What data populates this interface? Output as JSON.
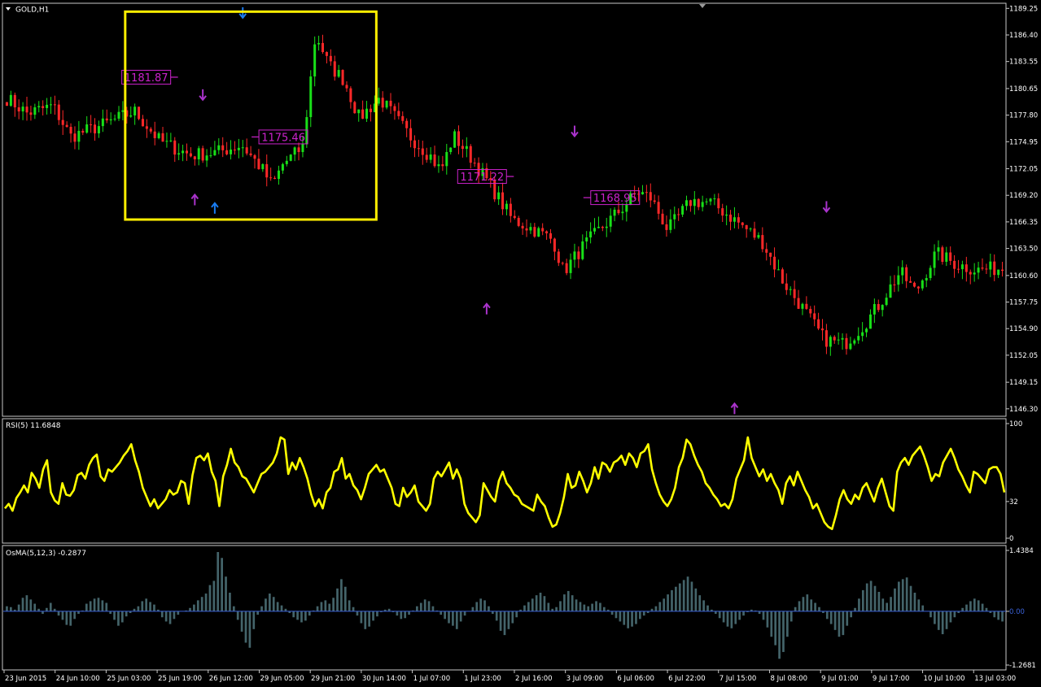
{
  "symbol": "GOLD,H1",
  "colors": {
    "background": "#000000",
    "frame": "#c8c8c8",
    "bull_candle": "#18e018",
    "bear_candle": "#ff2828",
    "rsi_line": "#ffff00",
    "osma_bar": "#44646a",
    "osma_zero": "#3a62d8",
    "highlight_box": "#ffee00",
    "fractal_label": "#cc22cc",
    "arrow_blue": "#1a7cf0",
    "arrow_purple": "#aa33cc"
  },
  "icons": {
    "menu_triangle": "triangle-down-icon",
    "arrow_up": "arrow-up-icon",
    "arrow_down": "arrow-down-icon"
  },
  "chart_data": [
    {
      "type": "candlestick",
      "title": "GOLD,H1",
      "ylim": [
        1145.5,
        1189.8
      ],
      "y_ticks": [
        "1189.25",
        "1186.40",
        "1183.55",
        "1180.65",
        "1177.80",
        "1174.95",
        "1172.05",
        "1169.20",
        "1166.35",
        "1163.50",
        "1160.60",
        "1157.75",
        "1154.90",
        "1152.05",
        "1149.15",
        "1146.30"
      ],
      "x_ticks": [
        "23 Jun 2015",
        "24 Jun 10:00",
        "25 Jun 03:00",
        "25 Jun 19:00",
        "26 Jun 12:00",
        "29 Jun 05:00",
        "29 Jun 21:00",
        "30 Jun 14:00",
        "1 Jul 07:00",
        "1 Jul 23:00",
        "2 Jul 16:00",
        "3 Jul 09:00",
        "6 Jul 06:00",
        "6 Jul 22:00",
        "7 Jul 15:00",
        "8 Jul 08:00",
        "9 Jul 01:00",
        "9 Jul 17:00",
        "10 Jul 10:00",
        "13 Jul 03:00"
      ],
      "bars": 250,
      "path_anchors": [
        [
          0,
          1179.6
        ],
        [
          8,
          1178.0
        ],
        [
          18,
          1178.8
        ],
        [
          25,
          1175.5
        ],
        [
          38,
          1176.8
        ],
        [
          50,
          1178.2
        ],
        [
          60,
          1175.0
        ],
        [
          72,
          1173.5
        ],
        [
          82,
          1173.8
        ],
        [
          92,
          1174.6
        ],
        [
          100,
          1172.0
        ],
        [
          104,
          1170.2
        ],
        [
          108,
          1172.5
        ],
        [
          116,
          1174.4
        ],
        [
          121,
          1186.6
        ],
        [
          126,
          1183.2
        ],
        [
          132,
          1181.6
        ],
        [
          138,
          1177.5
        ],
        [
          146,
          1179.6
        ],
        [
          152,
          1177.6
        ],
        [
          158,
          1175.5
        ],
        [
          166,
          1173.4
        ],
        [
          170,
          1171.8
        ],
        [
          175,
          1175.6
        ],
        [
          182,
          1173.2
        ],
        [
          190,
          1170.0
        ],
        [
          198,
          1166.6
        ],
        [
          206,
          1165.6
        ],
        [
          214,
          1164.4
        ],
        [
          218,
          1161.0
        ],
        [
          226,
          1163.8
        ],
        [
          234,
          1166.0
        ],
        [
          241,
          1167.8
        ],
        [
          247,
          1169.6
        ],
        [
          252,
          1169.0
        ],
        [
          259,
          1165.5
        ],
        [
          268,
          1168.6
        ],
        [
          276,
          1168.4
        ],
        [
          285,
          1166.6
        ],
        [
          296,
          1164.2
        ],
        [
          304,
          1160.0
        ],
        [
          312,
          1157.0
        ],
        [
          320,
          1153.8
        ],
        [
          328,
          1153.2
        ],
        [
          336,
          1155.4
        ],
        [
          342,
          1157.6
        ],
        [
          350,
          1161.0
        ],
        [
          356,
          1158.8
        ],
        [
          364,
          1163.0
        ],
        [
          372,
          1161.8
        ],
        [
          380,
          1161.2
        ],
        [
          390,
          1161.4
        ]
      ],
      "markers": [
        {
          "bar": 74,
          "dir": "up",
          "color": "purple",
          "price": 1169.0
        },
        {
          "bar": 76,
          "dir": "down",
          "color": "purple",
          "price": 1179.7
        },
        {
          "bar": 82,
          "dir": "up",
          "color": "blue",
          "price": 1168.1
        },
        {
          "bar": 92,
          "dir": "down",
          "color": "blue",
          "price": 1188.5
        },
        {
          "bar": 188,
          "dir": "up",
          "color": "purple",
          "price": 1157.3
        },
        {
          "bar": 222,
          "dir": "down",
          "color": "purple",
          "price": 1175.8
        },
        {
          "bar": 285,
          "dir": "up",
          "color": "purple",
          "price": 1146.6
        },
        {
          "bar": 320,
          "dir": "down",
          "color": "purple",
          "price": 1167.7
        }
      ],
      "price_labels": [
        {
          "text": "1181.87",
          "bar": 67,
          "price": 1181.87,
          "side": "left"
        },
        {
          "text": "1175.46",
          "bar": 95,
          "price": 1175.46,
          "side": "right"
        },
        {
          "text": "1171.22",
          "bar": 198,
          "price": 1171.22,
          "side": "left"
        },
        {
          "text": "1168.95",
          "bar": 225,
          "price": 1168.95,
          "side": "right"
        }
      ],
      "highlight_box": {
        "bar_start": 47,
        "bar_end": 144,
        "price_top": 1188.9,
        "price_bottom": 1166.6
      },
      "top_marker": "triangle-down-icon"
    },
    {
      "type": "line",
      "title": "RSI(5) 11.6848",
      "ylim": [
        0,
        100
      ],
      "y_ticks": [
        "100",
        "32",
        "0"
      ],
      "series": [
        {
          "values": [
            26,
            30,
            24,
            35,
            40,
            46,
            40,
            57,
            52,
            44,
            60,
            68,
            40,
            33,
            30,
            48,
            38,
            37,
            42,
            55,
            57,
            52,
            64,
            70,
            73,
            54,
            50,
            60,
            58,
            62,
            66,
            72,
            76,
            82,
            68,
            58,
            44,
            36,
            28,
            34,
            26,
            30,
            34,
            42,
            38,
            40,
            50,
            48,
            30,
            55,
            70,
            72,
            68,
            74,
            58,
            50,
            28,
            54,
            64,
            78,
            66,
            62,
            54,
            52,
            46,
            40,
            48,
            56,
            58,
            62,
            66,
            74,
            88,
            86,
            56,
            66,
            60,
            70,
            62,
            52,
            38,
            28,
            34,
            26,
            40,
            44,
            58,
            60,
            70,
            52,
            56,
            46,
            42,
            34,
            44,
            56,
            60,
            64,
            58,
            60,
            52,
            44,
            30,
            28,
            44,
            36,
            40,
            46,
            32,
            28,
            24,
            30,
            52,
            58,
            54,
            60,
            66,
            52,
            60,
            52,
            30,
            22,
            18,
            14,
            20,
            48,
            42,
            36,
            32,
            50,
            58,
            48,
            44,
            38,
            36,
            30,
            28,
            26,
            24,
            38,
            32,
            28,
            18,
            10,
            12,
            22,
            36,
            56,
            44,
            46,
            58,
            50,
            40,
            48,
            62,
            52,
            66,
            64,
            58,
            66,
            68,
            72,
            64,
            74,
            70,
            62,
            74,
            76,
            82,
            60,
            48,
            38,
            32,
            28,
            34,
            44,
            62,
            70,
            86,
            82,
            72,
            64,
            58,
            48,
            44,
            38,
            34,
            28,
            30,
            26,
            34,
            52,
            60,
            68,
            88,
            70,
            62,
            54,
            60,
            50,
            56,
            48,
            42,
            30,
            48,
            54,
            46,
            58,
            50,
            42,
            36,
            26,
            30,
            22,
            14,
            10,
            8,
            20,
            34,
            42,
            34,
            30,
            38,
            34,
            44,
            48,
            40,
            32,
            44,
            52,
            40,
            28,
            24,
            58,
            66,
            70,
            64,
            72,
            76,
            80,
            72,
            62,
            50,
            56,
            54,
            66,
            72,
            78,
            70,
            60,
            54,
            46,
            40,
            58,
            56,
            52,
            48,
            60,
            62,
            62,
            56,
            40
          ]
        }
      ]
    },
    {
      "type": "bar",
      "title": "OsMA(5,12,3) -0.2877",
      "ylim": [
        -1.2681,
        1.4384
      ],
      "y_ticks": [
        "1.4384",
        "0.00",
        "-1.2681"
      ],
      "series": [
        {
          "values": [
            0.12,
            0.1,
            0.04,
            0.16,
            0.32,
            0.38,
            0.28,
            0.18,
            0.06,
            -0.06,
            0.08,
            0.2,
            0.06,
            -0.1,
            -0.2,
            -0.32,
            -0.34,
            -0.18,
            -0.06,
            0.02,
            0.18,
            0.24,
            0.3,
            0.32,
            0.26,
            0.2,
            -0.06,
            -0.2,
            -0.34,
            -0.26,
            -0.12,
            -0.04,
            0.06,
            0.12,
            0.24,
            0.3,
            0.22,
            0.16,
            0.04,
            -0.14,
            -0.24,
            -0.3,
            -0.18,
            -0.08,
            0.0,
            0.02,
            0.08,
            0.16,
            0.26,
            0.34,
            0.42,
            0.62,
            0.72,
            1.4,
            1.26,
            0.82,
            0.44,
            0.12,
            -0.2,
            -0.48,
            -0.74,
            -0.86,
            -0.42,
            -0.08,
            0.12,
            0.3,
            0.42,
            0.34,
            0.22,
            0.14,
            0.06,
            -0.04,
            -0.14,
            -0.2,
            -0.26,
            -0.22,
            -0.1,
            0.02,
            0.12,
            0.22,
            0.26,
            0.18,
            0.32,
            0.54,
            0.76,
            0.58,
            0.26,
            0.1,
            -0.1,
            -0.28,
            -0.42,
            -0.36,
            -0.22,
            -0.12,
            -0.02,
            0.04,
            0.06,
            -0.02,
            -0.1,
            -0.18,
            -0.16,
            -0.08,
            0.02,
            0.12,
            0.2,
            0.28,
            0.24,
            0.12,
            0.02,
            -0.08,
            -0.18,
            -0.28,
            -0.34,
            -0.42,
            -0.24,
            -0.1,
            0.0,
            0.1,
            0.22,
            0.3,
            0.26,
            0.12,
            -0.06,
            -0.22,
            -0.46,
            -0.56,
            -0.42,
            -0.28,
            -0.14,
            0.04,
            0.14,
            0.22,
            0.3,
            0.38,
            0.44,
            0.36,
            0.2,
            0.06,
            0.1,
            0.24,
            0.4,
            0.48,
            0.38,
            0.28,
            0.22,
            0.16,
            0.12,
            0.18,
            0.24,
            0.2,
            0.1,
            0.04,
            -0.08,
            -0.16,
            -0.24,
            -0.32,
            -0.4,
            -0.36,
            -0.3,
            -0.18,
            -0.1,
            -0.04,
            0.06,
            0.12,
            0.22,
            0.3,
            0.4,
            0.5,
            0.58,
            0.66,
            0.74,
            0.82,
            0.7,
            0.54,
            0.38,
            0.26,
            0.14,
            0.04,
            -0.06,
            -0.16,
            -0.26,
            -0.36,
            -0.4,
            -0.3,
            -0.2,
            -0.1,
            -0.02,
            0.04,
            0.02,
            -0.06,
            -0.2,
            -0.38,
            -0.6,
            -0.8,
            -1.12,
            -0.96,
            -0.6,
            -0.24,
            0.1,
            0.24,
            0.34,
            0.4,
            0.28,
            0.2,
            0.1,
            -0.04,
            -0.18,
            -0.3,
            -0.44,
            -0.6,
            -0.56,
            -0.34,
            -0.14,
            0.08,
            0.3,
            0.5,
            0.66,
            0.72,
            0.6,
            0.46,
            0.3,
            0.2,
            0.34,
            0.54,
            0.7,
            0.76,
            0.8,
            0.6,
            0.44,
            0.28,
            0.14,
            0.0,
            -0.14,
            -0.3,
            -0.44,
            -0.54,
            -0.42,
            -0.26,
            -0.14,
            -0.04,
            0.08,
            0.16,
            0.24,
            0.3,
            0.26,
            0.18,
            0.08,
            -0.04,
            -0.14,
            -0.2,
            -0.24
          ]
        }
      ]
    }
  ]
}
